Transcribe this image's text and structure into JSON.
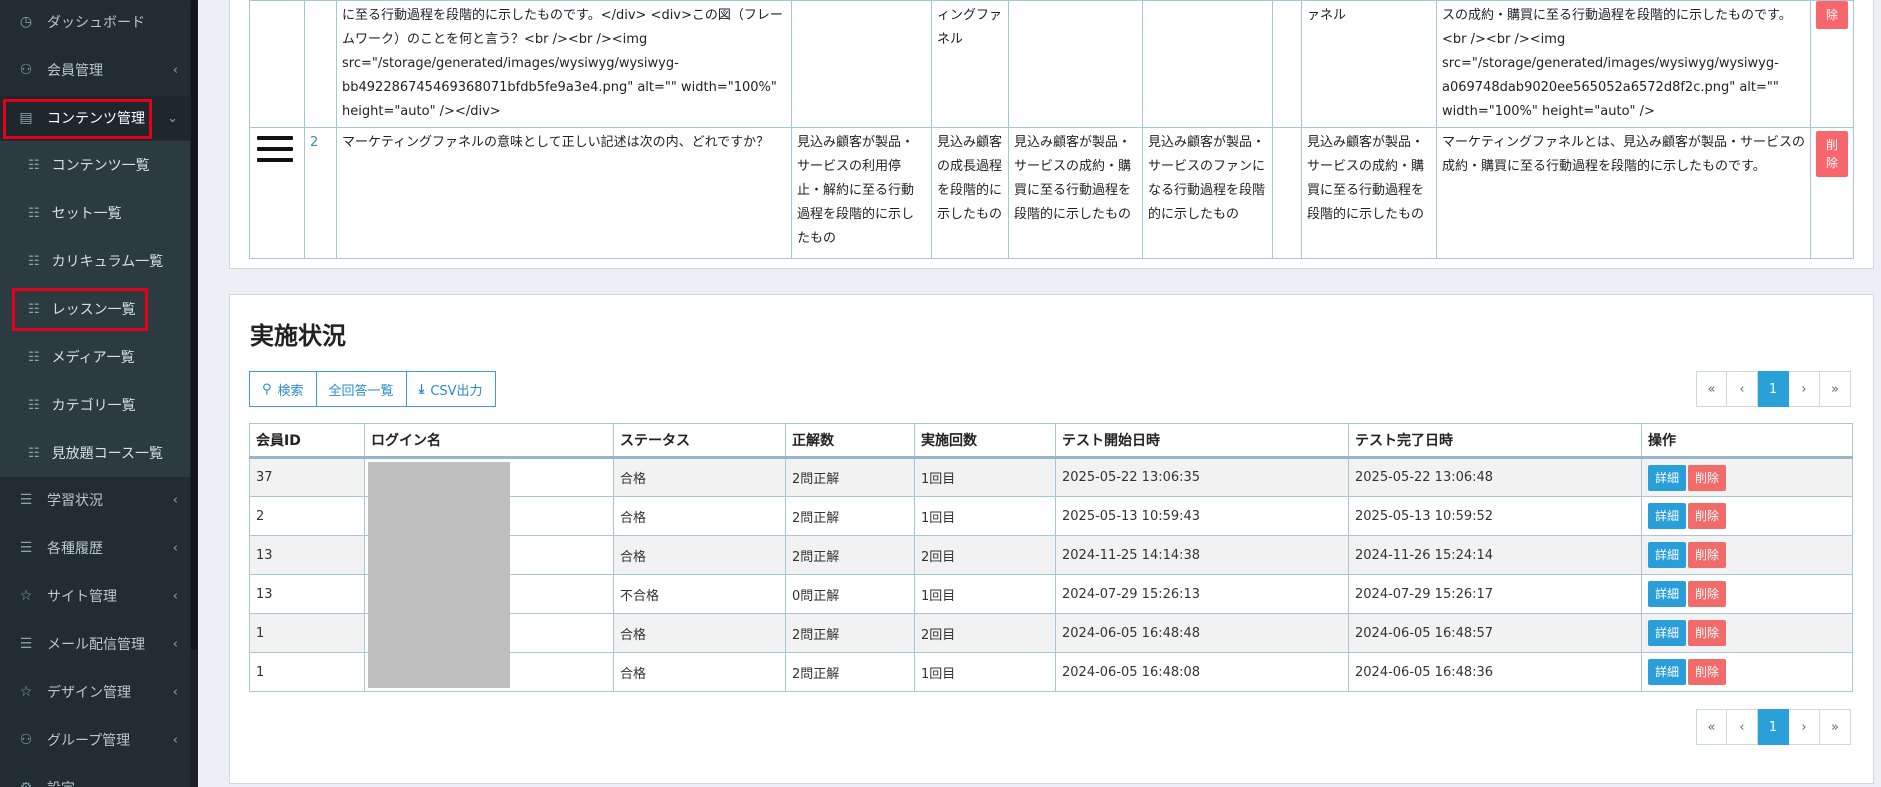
{
  "sidebar": {
    "items": [
      {
        "label": "ダッシュボード",
        "icon": "dashboard-icon",
        "glyph": "◷",
        "chevron": ""
      },
      {
        "label": "会員管理",
        "icon": "users-icon",
        "glyph": "⚇",
        "chevron": "‹"
      },
      {
        "label": "コンテンツ管理",
        "icon": "book-icon",
        "glyph": "▤",
        "chevron": "⌄"
      },
      {
        "label": "学習状況",
        "icon": "list-icon",
        "glyph": "☰",
        "chevron": "‹"
      },
      {
        "label": "各種履歴",
        "icon": "list-icon",
        "glyph": "☰",
        "chevron": "‹"
      },
      {
        "label": "サイト管理",
        "icon": "star-icon",
        "glyph": "☆",
        "chevron": "‹"
      },
      {
        "label": "メール配信管理",
        "icon": "list-icon",
        "glyph": "☰",
        "chevron": "‹"
      },
      {
        "label": "デザイン管理",
        "icon": "star-icon",
        "glyph": "☆",
        "chevron": "‹"
      },
      {
        "label": "グループ管理",
        "icon": "users-icon",
        "glyph": "⚇",
        "chevron": "‹"
      },
      {
        "label": "設定",
        "icon": "gear-icon",
        "glyph": "⚙",
        "chevron": ""
      }
    ],
    "sub_items": [
      {
        "label": "コンテンツ一覧"
      },
      {
        "label": "セット一覧"
      },
      {
        "label": "カリキュラム一覧"
      },
      {
        "label": "レッスン一覧"
      },
      {
        "label": "メディア一覧"
      },
      {
        "label": "カテゴリ一覧"
      },
      {
        "label": "見放題コース一覧"
      }
    ]
  },
  "questions": {
    "row1": {
      "question_tail": "に至る行動過程を段階的に示したものです。</div> <div>この図（フレームワーク）のことを何と言う？<br /><br /><img src=\"/storage/generated/images/wysiwyg/wysiwyg-bb492286745469368071bfdb5fe9a3e4.png\" alt=\"\" width=\"100%\" height=\"auto\" /></div>",
      "col3": "ィングファネル",
      "col6": "ァネル",
      "explanation": "スの成約・購買に至る行動過程を段階的に示したものです。<br /><br /><img src=\"/storage/generated/images/wysiwyg/wysiwyg-a069748dab9020ee565052a6572d8f2c.png\" alt=\"\" width=\"100%\" height=\"auto\" />",
      "delete": "除"
    },
    "row2": {
      "number": "2",
      "question": "マーケティングファネルの意味として正しい記述は次の内、どれですか？",
      "choice1": "見込み顧客が製品・サービスの利用停止・解約に至る行動過程を段階的に示したもの",
      "choice2": "見込み顧客の成長過程を段階的に示したもの",
      "choice3": "見込み顧客が製品・サービスの成約・購買に至る行動過程を段階的に示したもの",
      "choice4": "見込み顧客が製品・サービスのファンになる行動過程を段階的に示したもの",
      "answer": "見込み顧客が製品・サービスの成約・購買に至る行動過程を段階的に示したもの",
      "explanation": "マーケティングファネルとは、見込み顧客が製品・サービスの成約・購買に至る行動過程を段階的に示したものです。",
      "delete": "削除"
    }
  },
  "status_section": {
    "title": "実施状況",
    "buttons": {
      "search": "検索",
      "all_answers": "全回答一覧",
      "csv": "CSV出力"
    },
    "pager": {
      "first": "«",
      "prev": "‹",
      "page": "1",
      "next": "›",
      "last": "»"
    },
    "headers": {
      "member_id": "会員ID",
      "login": "ログイン名",
      "status": "ステータス",
      "correct": "正解数",
      "attempts": "実施回数",
      "start": "テスト開始日時",
      "end": "テスト完了日時",
      "ops": "操作"
    },
    "op_labels": {
      "detail": "詳細",
      "delete": "削除"
    },
    "rows": [
      {
        "member_id": "37",
        "status": "合格",
        "correct": "2問正解",
        "attempts": "1回目",
        "start": "2025-05-22 13:06:35",
        "end": "2025-05-22 13:06:48"
      },
      {
        "member_id": "2",
        "status": "合格",
        "correct": "2問正解",
        "attempts": "1回目",
        "start": "2025-05-13 10:59:43",
        "end": "2025-05-13 10:59:52"
      },
      {
        "member_id": "13",
        "status": "合格",
        "correct": "2問正解",
        "attempts": "2回目",
        "start": "2024-11-25 14:14:38",
        "end": "2024-11-26 15:24:14"
      },
      {
        "member_id": "13",
        "status": "不合格",
        "correct": "0問正解",
        "attempts": "1回目",
        "start": "2024-07-29 15:26:13",
        "end": "2024-07-29 15:26:17"
      },
      {
        "member_id": "1",
        "status": "合格",
        "correct": "2問正解",
        "attempts": "2回目",
        "start": "2024-06-05 16:48:48",
        "end": "2024-06-05 16:48:57"
      },
      {
        "member_id": "1",
        "status": "合格",
        "correct": "2問正解",
        "attempts": "1回目",
        "start": "2024-06-05 16:48:08",
        "end": "2024-06-05 16:48:36"
      }
    ]
  },
  "colors": {
    "sidebar_bg": "#222d32",
    "highlight": "#e3001b",
    "primary": "#2aa0d8",
    "danger": "#f26b6b"
  }
}
